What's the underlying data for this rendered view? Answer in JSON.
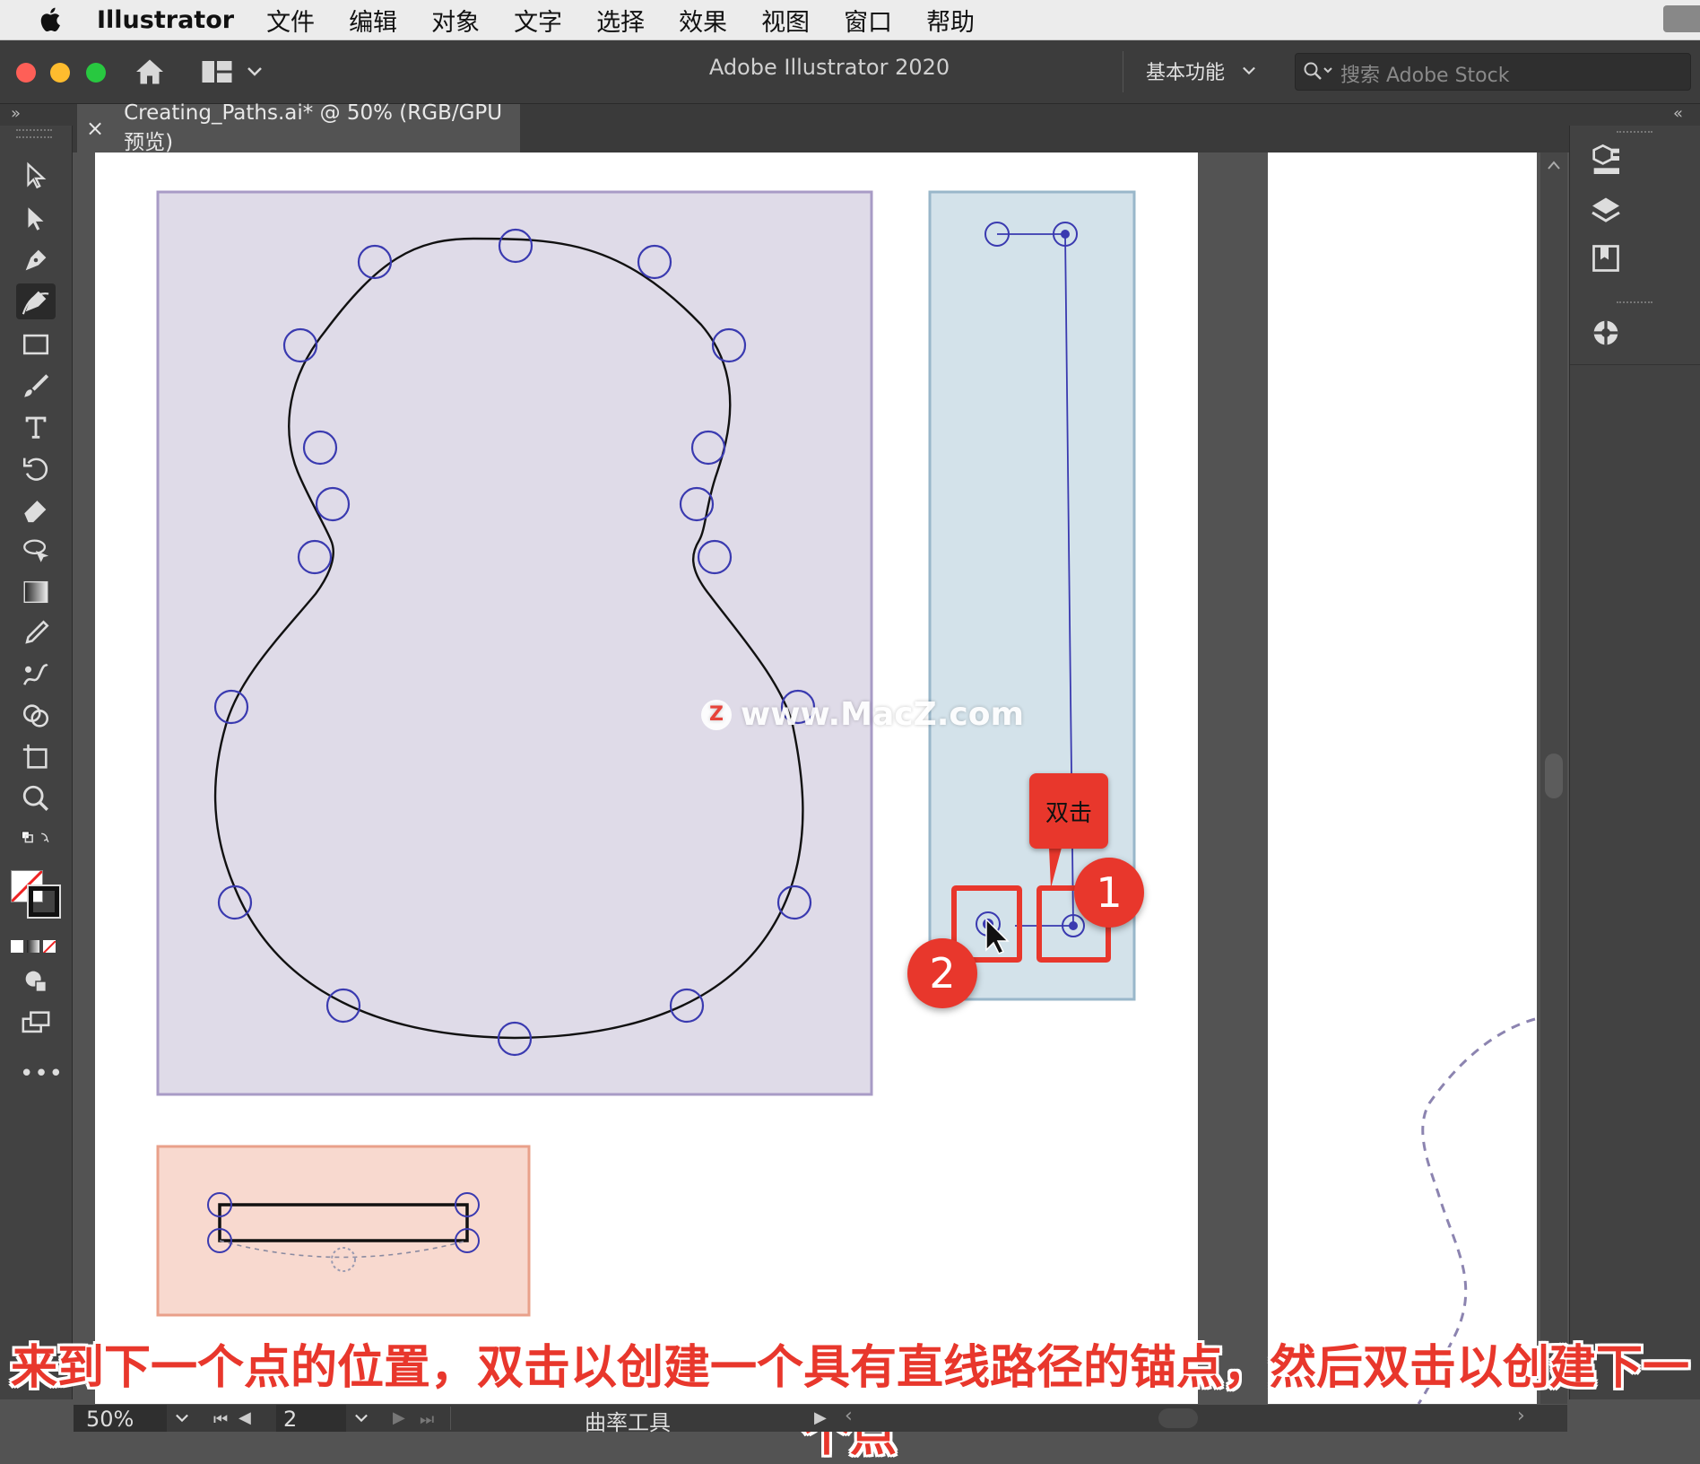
{
  "menubar": {
    "app_name": "Illustrator",
    "items": [
      "文件",
      "编辑",
      "对象",
      "文字",
      "选择",
      "效果",
      "视图",
      "窗口",
      "帮助"
    ]
  },
  "titlebar": {
    "title": "Adobe Illustrator 2020",
    "workspace": "基本功能",
    "search_placeholder": "搜索 Adobe Stock"
  },
  "document_tab": {
    "close": "×",
    "title": "Creating_Paths.ai* @ 50% (RGB/GPU 预览)"
  },
  "callouts": {
    "double_click_label": "双击",
    "badge_1": "1",
    "badge_2": "2"
  },
  "watermark": "www.MacZ.com",
  "watermark_logo": "Z",
  "statusbar": {
    "zoom": "50%",
    "artboard": "2",
    "tool_name": "曲率工具"
  },
  "caption": "来到下一个点的位置，双击以创建一个具有直线路径的锚点，然后双击以创建下一个点",
  "colors": {
    "purple_board": "#dfdbe8",
    "blue_board": "#d3e2ea",
    "salmon_board": "#f8d9cf",
    "anchor": "#3a3ab0",
    "highlight_red": "#e8372c"
  }
}
